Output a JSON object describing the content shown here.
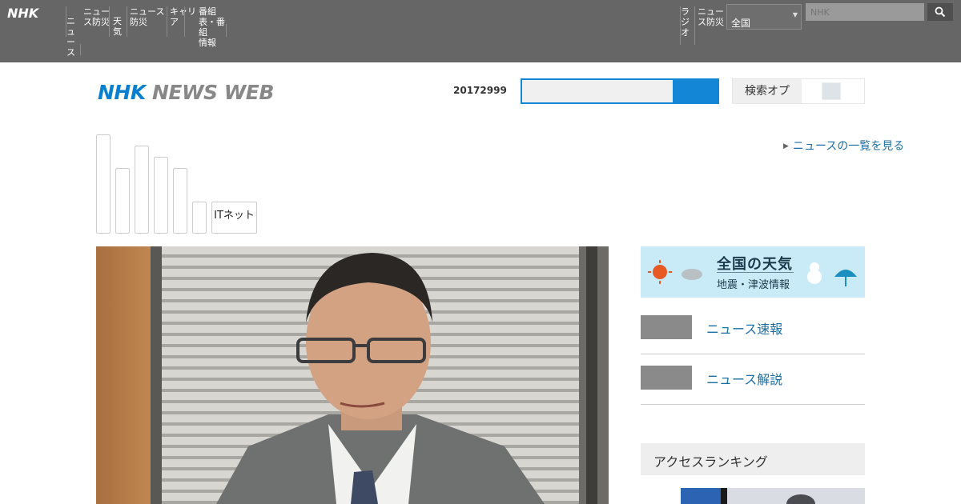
{
  "topbar": {
    "logo": "NHK",
    "nav_items": [
      "ニュ\nース",
      "ニュー\nス防災",
      "天気",
      "ニュース\n防災",
      "キャリ\nア",
      "番組\n表・番組\n情報"
    ],
    "right_items": [
      "ラジ\nオ",
      "ニュー\nス防災"
    ],
    "select_value": "全国",
    "search_placeholder": "NHK"
  },
  "header": {
    "site_logo_nhk": "NHK",
    "site_logo_rest": "NEWS WEB",
    "date": "20172999",
    "dropdown_label": "検索オプ"
  },
  "side_link": "ニュースの一覧を見る",
  "categories": {
    "it_label": "ITネット"
  },
  "right_column": {
    "weather_title": "全国の天気",
    "weather_sub": "地震・津波情報",
    "items": [
      "ニュース速報",
      "ニュース解説"
    ],
    "ranking_header": "アクセスランキング"
  },
  "colors": {
    "topbar_bg": "#666666",
    "accent_blue": "#1386d6",
    "link_blue": "#1a6ea3"
  }
}
